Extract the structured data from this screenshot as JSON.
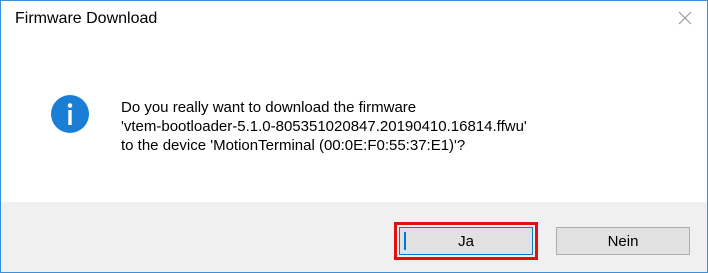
{
  "window": {
    "title": "Firmware Download",
    "close_icon": "close-icon"
  },
  "message": {
    "icon": "info-icon",
    "lines": [
      "Do you really want to download the firmware",
      "'vtem-bootloader-5.1.0-805351020847.20190410.16814.ffwu'",
      "to the device 'MotionTerminal (00:0E:F0:55:37:E1)'?"
    ]
  },
  "buttons": {
    "yes_label": "Ja",
    "no_label": "Nein"
  },
  "colors": {
    "window_border": "#3c8ed6",
    "info_icon": "#1a7fd4",
    "footer_bg": "#f0f0f0",
    "highlight": "#e01010",
    "focus": "#0078d7"
  }
}
